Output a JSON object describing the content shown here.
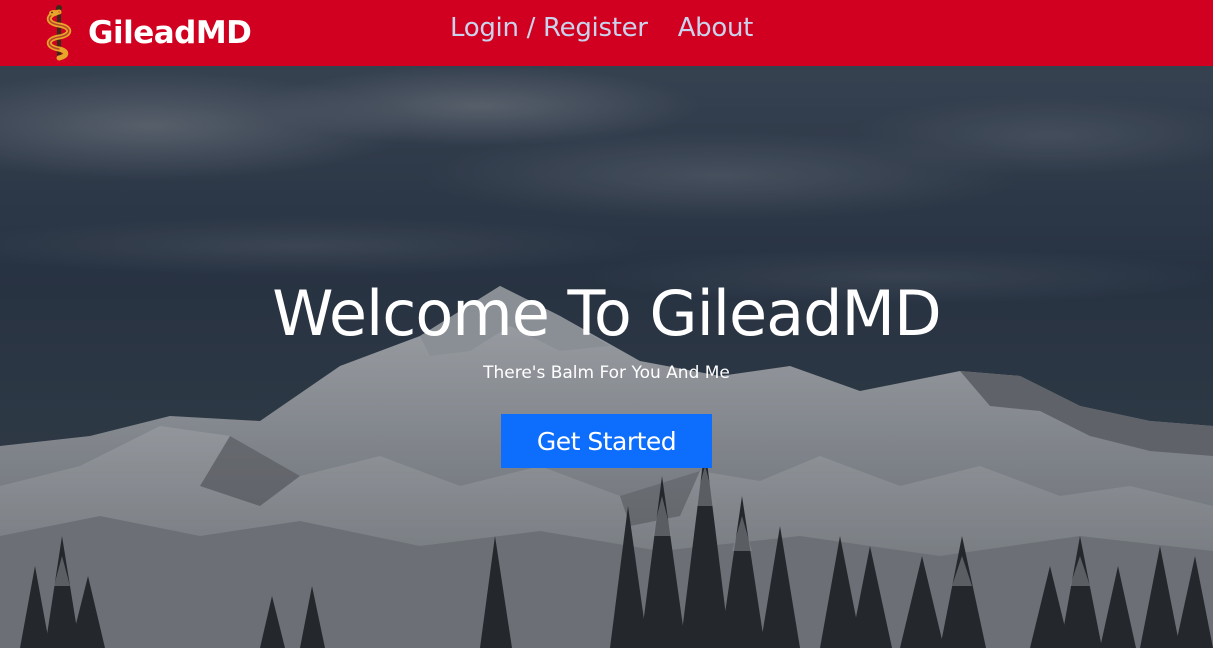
{
  "navbar": {
    "brand_name": "GileadMD",
    "logo_icon": "caduceus-snake-icon",
    "links": [
      {
        "label": "Login / Register"
      },
      {
        "label": "About"
      }
    ],
    "colors": {
      "background": "#d20020",
      "link": "#c9d4ec",
      "brand": "#ffffff"
    }
  },
  "hero": {
    "background_image": "snowy-mountain-landscape",
    "title": "Welcome To GileadMD",
    "subtitle": "There's Balm For You And Me",
    "cta_label": "Get Started",
    "colors": {
      "cta_background": "#0d6efd",
      "text": "#ffffff"
    }
  }
}
